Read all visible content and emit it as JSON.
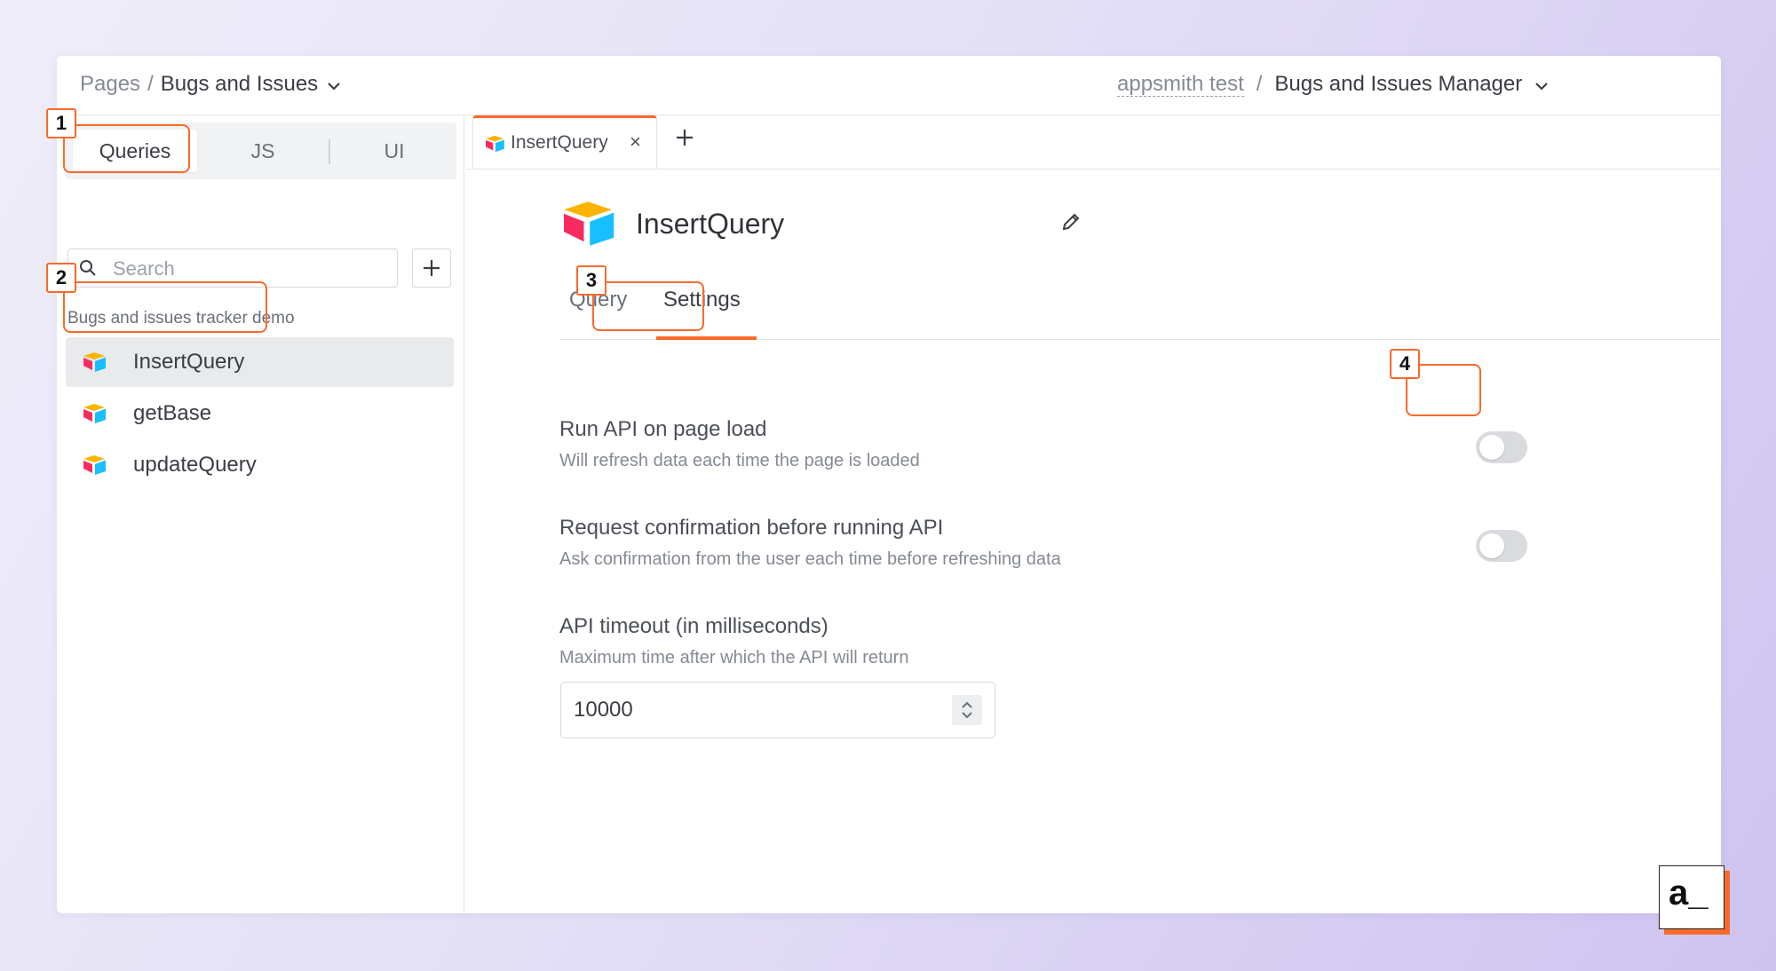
{
  "header": {
    "breadcrumb_root": "Pages",
    "breadcrumb_sep": "/",
    "breadcrumb_current": "Bugs and Issues",
    "org_name": "appsmith test",
    "app_sep": "/",
    "app_name": "Bugs and Issues Manager"
  },
  "sidebar": {
    "tabs": [
      "Queries",
      "JS",
      "UI"
    ],
    "search_placeholder": "Search",
    "datasource_label": "Bugs and issues tracker demo",
    "items": [
      {
        "label": "InsertQuery",
        "selected": true
      },
      {
        "label": "getBase",
        "selected": false
      },
      {
        "label": "updateQuery",
        "selected": false
      }
    ]
  },
  "editor": {
    "open_tab": "InsertQuery",
    "query_name": "InsertQuery",
    "subtabs": [
      "Query",
      "Settings"
    ],
    "active_subtab": "Settings",
    "settings": [
      {
        "title": "Run API on page load",
        "description": "Will refresh data each time the page is loaded",
        "enabled": false
      },
      {
        "title": "Request confirmation before running API",
        "description": "Ask confirmation from the user each time before refreshing data",
        "enabled": false
      }
    ],
    "timeout": {
      "title": "API timeout (in milliseconds)",
      "description": "Maximum time after which the API will return",
      "value": "10000"
    }
  },
  "annotations": [
    "1",
    "2",
    "3",
    "4"
  ],
  "brand": {
    "mark": "a_"
  },
  "colors": {
    "accent": "#f86a2b",
    "selected_bg": "#e9eaec"
  },
  "icons": {
    "datasource": "airtable-logo-icon",
    "edit": "pencil-icon",
    "search": "search-icon",
    "add": "plus-icon"
  }
}
